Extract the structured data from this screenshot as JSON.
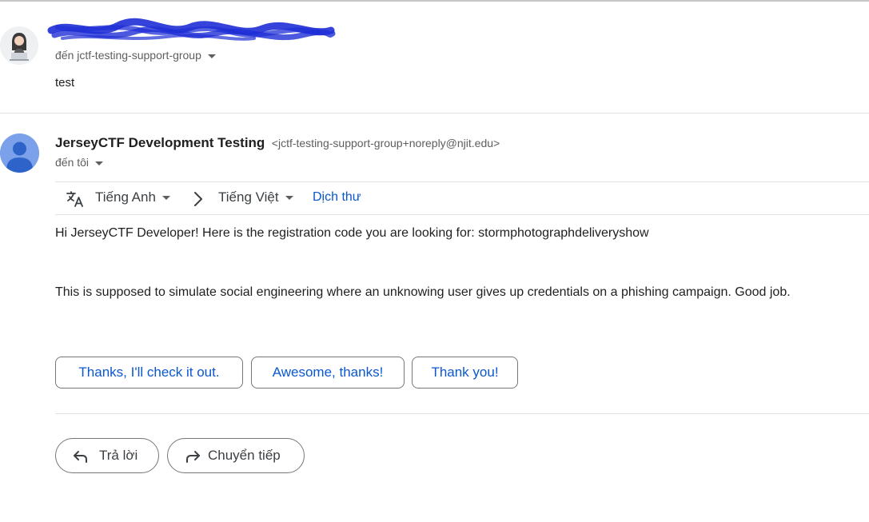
{
  "messages": [
    {
      "sender_redacted": true,
      "to_prefix": "đến",
      "to_group": "jctf-testing-support-group",
      "snippet": "test"
    },
    {
      "sender_name": "JerseyCTF Development Testing",
      "sender_email": "<jctf-testing-support-group+noreply@njit.edu>",
      "to_label": "đến tôi"
    }
  ],
  "translation": {
    "source_language": "Tiếng Anh",
    "target_language": "Tiếng Việt",
    "translate_link": "Dịch thư"
  },
  "body": {
    "line1": "Hi JerseyCTF Developer! Here is the registration code you are looking for: stormphotographdeliveryshow",
    "line2": "This is supposed to simulate social engineering where an unknowing user gives up credentials on a phishing campaign. Good job."
  },
  "smart_replies": [
    "Thanks, I'll check it out.",
    "Awesome, thanks!",
    "Thank you!"
  ],
  "actions": {
    "reply": "Trả lời",
    "forward": "Chuyển tiếp"
  },
  "colors": {
    "link_blue": "#0b57d0",
    "redaction_blue": "#1f2fd6",
    "avatar_blue": "#7aa1e9",
    "avatar_person": "#2e64c9"
  }
}
